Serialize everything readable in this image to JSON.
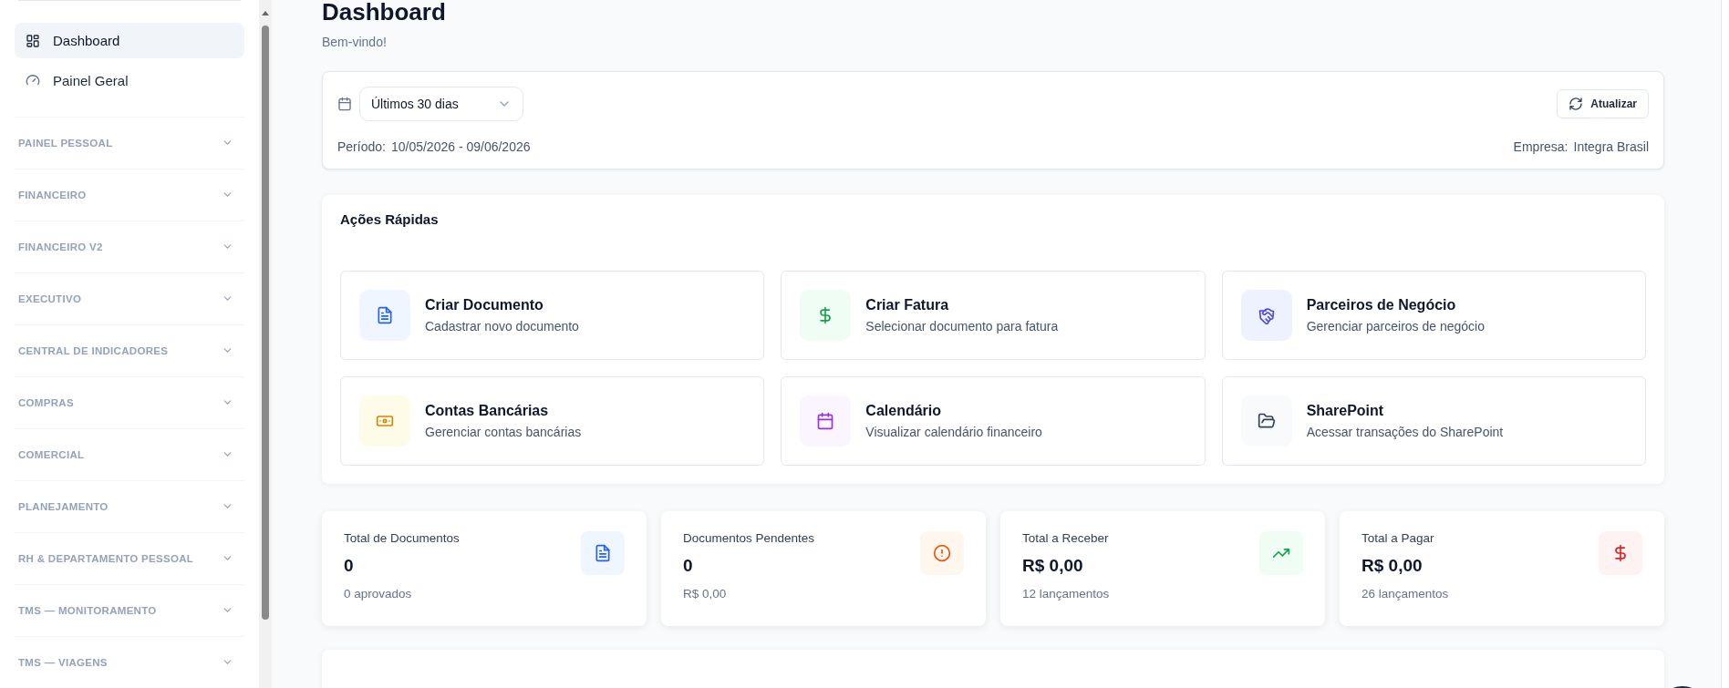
{
  "sidebar": {
    "items": [
      {
        "label": "Dashboard",
        "kind": "grid",
        "selected": true
      },
      {
        "label": "Painel Geral",
        "kind": "gauge",
        "selected": false
      }
    ],
    "sections": [
      "PAINEL PESSOAL",
      "FINANCEIRO",
      "FINANCEIRO V2",
      "EXECUTIVO",
      "CENTRAL DE INDICADORES",
      "COMPRAS",
      "COMERCIAL",
      "PLANEJAMENTO",
      "RH & DEPARTAMENTO PESSOAL",
      "TMS — MONITORAMENTO",
      "TMS — VIAGENS"
    ]
  },
  "header": {
    "title": "Dashboard",
    "subtitle": "Bem-vindo!"
  },
  "filter": {
    "range": "Últimos 30 dias",
    "refresh_label": "Atualizar",
    "period_label": "Período:",
    "period_value": "10/05/2026 - 09/06/2026",
    "company_label": "Empresa:",
    "company_value": "Integra Brasil"
  },
  "quick_actions": {
    "title": "Ações Rápidas",
    "items": [
      {
        "kind": "document",
        "title": "Criar Documento",
        "description": "Cadastrar novo documento"
      },
      {
        "kind": "dollar",
        "title": "Criar Fatura",
        "description": "Selecionar documento para fatura"
      },
      {
        "kind": "handshake",
        "title": "Parceiros de Negócio",
        "description": "Gerenciar parceiros de negócio"
      },
      {
        "kind": "banknote",
        "title": "Contas Bancárias",
        "description": "Gerenciar contas bancárias"
      },
      {
        "kind": "calendar",
        "title": "Calendário",
        "description": "Visualizar calendário financeiro"
      },
      {
        "kind": "folder",
        "title": "SharePoint",
        "description": "Acessar transações do SharePoint"
      }
    ]
  },
  "stats": [
    {
      "kind": "document",
      "label": "Total de Documentos",
      "value": "0",
      "note": "0 aprovados"
    },
    {
      "kind": "alert",
      "label": "Documentos Pendentes",
      "value": "0",
      "note": "R$ 0,00"
    },
    {
      "kind": "trend",
      "label": "Total a Receber",
      "value": "R$ 0,00",
      "note": "12 lançamentos"
    },
    {
      "kind": "money",
      "label": "Total a Pagar",
      "value": "R$ 0,00",
      "note": "26 lançamentos"
    }
  ]
}
